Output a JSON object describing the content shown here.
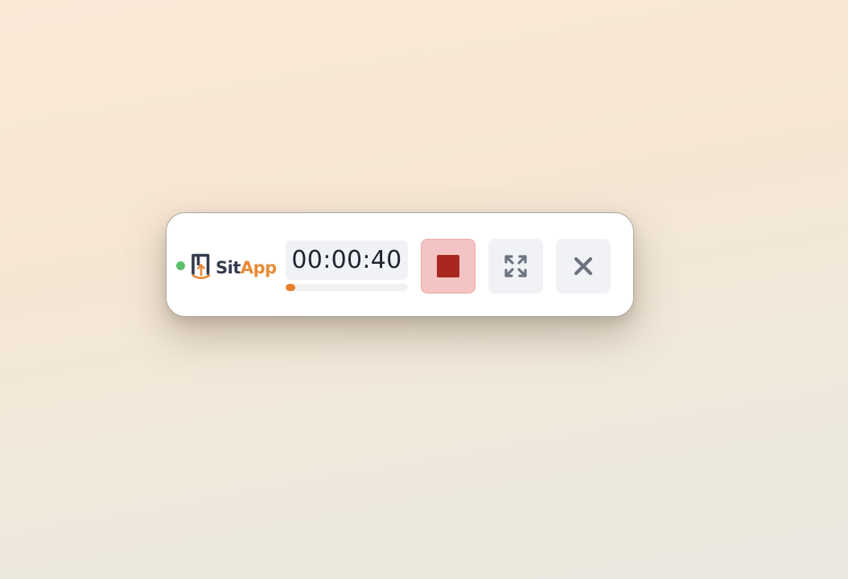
{
  "app": {
    "brand_part1": "Sit",
    "brand_part2": "App"
  },
  "status": {
    "state": "recording",
    "color": "#5cc06a"
  },
  "timer": {
    "elapsed": "00:00:40",
    "progress_fraction": 0.04
  },
  "controls": {
    "stop": {
      "icon": "stop-icon",
      "color": "#a8281f"
    },
    "expand": {
      "icon": "expand-icon",
      "color": "#6b7280"
    },
    "close": {
      "icon": "close-icon",
      "color": "#6b7280"
    }
  },
  "colors": {
    "brand_dark": "#353b4d",
    "brand_accent": "#ea8a35",
    "progress": "#e8802d"
  }
}
